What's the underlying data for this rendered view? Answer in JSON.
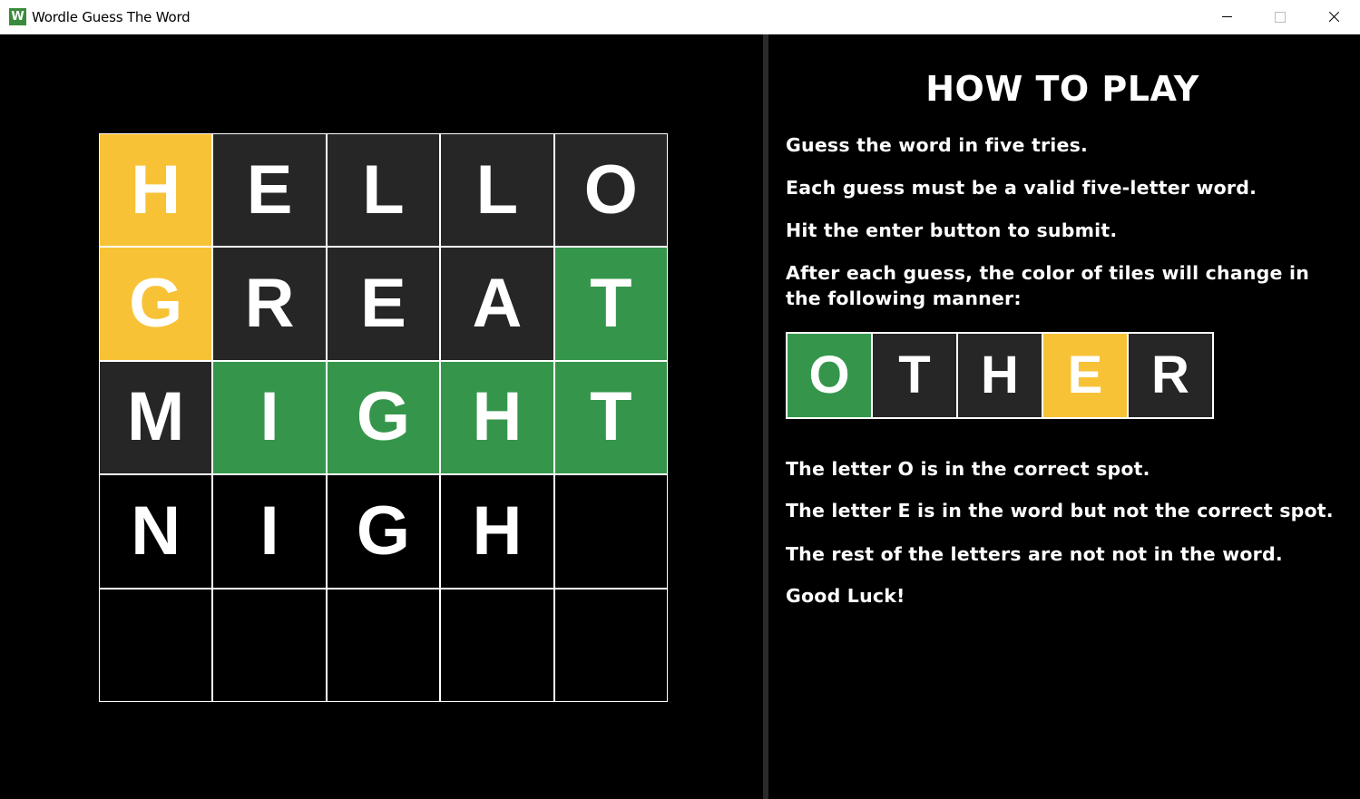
{
  "window": {
    "title": "Wordle Guess The Word",
    "icon_letter": "W",
    "controls": [
      "minimize-icon",
      "maximize-icon",
      "close-icon"
    ]
  },
  "colors": {
    "correct": "#35964b",
    "present": "#f8c236",
    "absent": "#262626",
    "empty": "#000000"
  },
  "board": {
    "rows": [
      [
        {
          "letter": "H",
          "state": "present"
        },
        {
          "letter": "E",
          "state": "absent"
        },
        {
          "letter": "L",
          "state": "absent"
        },
        {
          "letter": "L",
          "state": "absent"
        },
        {
          "letter": "O",
          "state": "absent"
        }
      ],
      [
        {
          "letter": "G",
          "state": "present"
        },
        {
          "letter": "R",
          "state": "absent"
        },
        {
          "letter": "E",
          "state": "absent"
        },
        {
          "letter": "A",
          "state": "absent"
        },
        {
          "letter": "T",
          "state": "correct"
        }
      ],
      [
        {
          "letter": "M",
          "state": "absent"
        },
        {
          "letter": "I",
          "state": "correct"
        },
        {
          "letter": "G",
          "state": "correct"
        },
        {
          "letter": "H",
          "state": "correct"
        },
        {
          "letter": "T",
          "state": "correct"
        }
      ],
      [
        {
          "letter": "N",
          "state": "empty"
        },
        {
          "letter": "I",
          "state": "empty"
        },
        {
          "letter": "G",
          "state": "empty"
        },
        {
          "letter": "H",
          "state": "empty"
        },
        {
          "letter": "",
          "state": "empty"
        }
      ],
      [
        {
          "letter": "",
          "state": "empty"
        },
        {
          "letter": "",
          "state": "empty"
        },
        {
          "letter": "",
          "state": "empty"
        },
        {
          "letter": "",
          "state": "empty"
        },
        {
          "letter": "",
          "state": "empty"
        }
      ]
    ]
  },
  "instructions": {
    "title": "HOW TO PLAY",
    "line1": "Guess the word in five tries.",
    "line2": "Each guess must be a valid five-letter word.",
    "line3": "Hit the enter button to submit.",
    "line4a": "After each guess, the color of tiles will change in",
    "line4b": "the following manner:",
    "example": [
      {
        "letter": "O",
        "state": "correct"
      },
      {
        "letter": "T",
        "state": "absent"
      },
      {
        "letter": "H",
        "state": "absent"
      },
      {
        "letter": "E",
        "state": "present"
      },
      {
        "letter": "R",
        "state": "absent"
      }
    ],
    "note1": "The letter O is in the correct spot.",
    "note2": "The letter E is in the word but not the correct spot.",
    "note3": "The rest of the letters are not not in the word.",
    "note4": "Good Luck!"
  }
}
